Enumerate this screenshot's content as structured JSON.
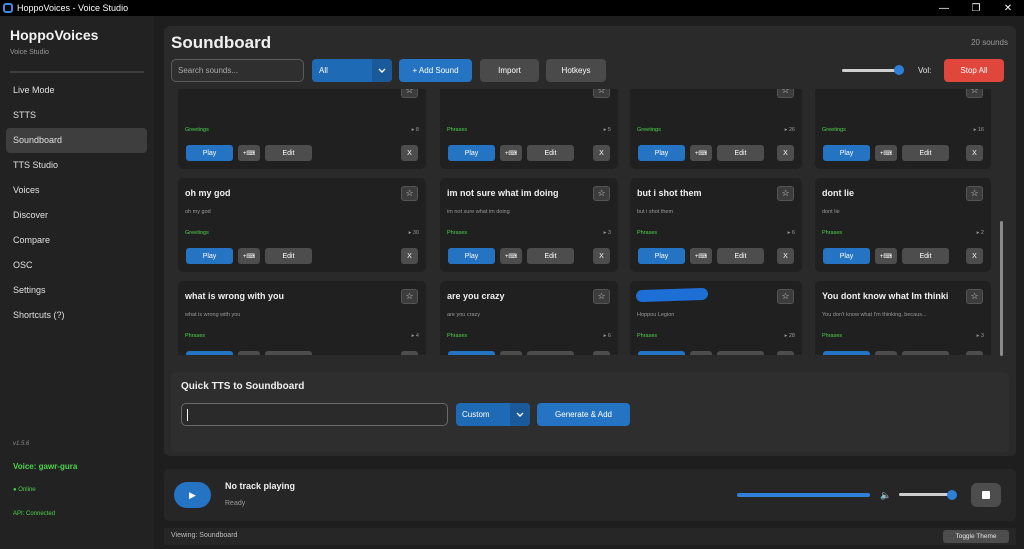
{
  "window": {
    "title": "HoppoVoices - Voice Studio",
    "minimize": "—",
    "maximize": "❐",
    "close": "✕"
  },
  "sidebar": {
    "brand": "HoppoVoices",
    "subtitle": "Voice Studio",
    "items": [
      {
        "label": "Live Mode"
      },
      {
        "label": "STTS"
      },
      {
        "label": "Soundboard",
        "active": true
      },
      {
        "label": "TTS Studio"
      },
      {
        "label": "Voices"
      },
      {
        "label": "Discover"
      },
      {
        "label": "Compare"
      },
      {
        "label": "OSC"
      },
      {
        "label": "Settings"
      },
      {
        "label": "Shortcuts (?)"
      }
    ],
    "version": "v1.5.6",
    "voice": "Voice: gawr-gura",
    "online": "● Online",
    "api": "API: Connected"
  },
  "main": {
    "title": "Soundboard",
    "count": "20 sounds",
    "search_placeholder": "Search sounds...",
    "filter_value": "All",
    "add_label": "+ Add Sound",
    "import_label": "Import",
    "hotkeys_label": "Hotkeys",
    "vol_label": "Vol:",
    "volume": 0.95,
    "stop_all_label": "Stop All"
  },
  "card_buttons": {
    "play": "Play",
    "hotkey": "+⌨",
    "edit": "Edit",
    "delete": "X",
    "star": "☆"
  },
  "cards": [
    {
      "title": "",
      "subtitle": "",
      "category": "Greetings",
      "plays": "▸ 8"
    },
    {
      "title": "",
      "subtitle": "",
      "category": "Phrases",
      "plays": "▸ 5"
    },
    {
      "title": "",
      "subtitle": "",
      "category": "Greetings",
      "plays": "▸ 26"
    },
    {
      "title": "",
      "subtitle": "",
      "category": "Greetings",
      "plays": "▸ 16"
    },
    {
      "title": "oh my god",
      "subtitle": "oh my god",
      "category": "Greetings",
      "plays": "▸ 30"
    },
    {
      "title": "im not sure what im doing",
      "subtitle": "im not sure what im doing",
      "category": "Phrases",
      "plays": "▸ 3"
    },
    {
      "title": "but i shot them",
      "subtitle": "but i shot them",
      "category": "Phrases",
      "plays": "▸ 6"
    },
    {
      "title": "dont lie",
      "subtitle": "dont lie",
      "category": "Phrases",
      "plays": "▸ 2"
    },
    {
      "title": "what is wrong with you",
      "subtitle": "what is wrong with you",
      "category": "Phrases",
      "plays": "▸ 4"
    },
    {
      "title": "are you crazy",
      "subtitle": "are you crazy",
      "category": "Phrases",
      "plays": "▸ 6"
    },
    {
      "title": "",
      "subtitle": "Hoppou Legion",
      "category": "Phrases",
      "plays": "▸ 28",
      "redacted": true
    },
    {
      "title": "You dont know what Im thinki",
      "subtitle": "You don't know what I'm thinking, becaus...",
      "category": "Phrases",
      "plays": "▸ 3"
    }
  ],
  "quick_tts": {
    "title": "Quick TTS to Soundboard",
    "voice_value": "Custom",
    "generate_label": "Generate & Add"
  },
  "player": {
    "play_icon": "▶",
    "track": "No track playing",
    "status": "Ready",
    "progress": 1.0,
    "speaker_icon": "🔈",
    "volume": 0.95
  },
  "statusbar": {
    "viewing": "Viewing: Soundboard",
    "toggle_theme": "Toggle Theme"
  },
  "colors": {
    "accent": "#2574c4",
    "danger": "#e0463b",
    "online": "#4cd34c"
  }
}
